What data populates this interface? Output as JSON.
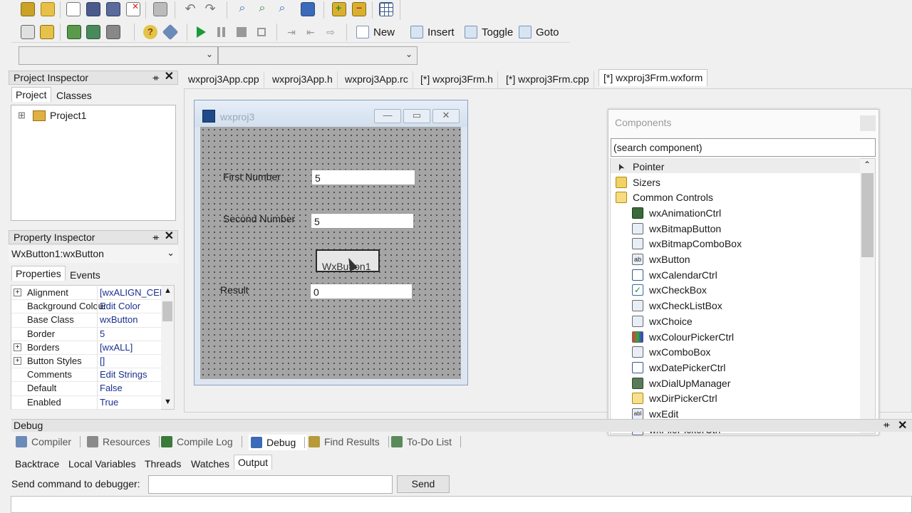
{
  "toolbar2": {
    "new": "New",
    "insert": "Insert",
    "toggle": "Toggle",
    "goto": "Goto"
  },
  "project_inspector": {
    "title": "Project Inspector",
    "pin": "ᚑ",
    "tabs": [
      "Project",
      "Classes"
    ],
    "tree_root": "Project1",
    "expander": "⊞"
  },
  "property_inspector": {
    "title": "Property Inspector",
    "object": "WxButton1:wxButton",
    "tabs": [
      "Properties",
      "Events"
    ],
    "rows": [
      {
        "key": "Alignment",
        "value": "[wxALIGN_CEN",
        "expandable": true
      },
      {
        "key": "Background Colour",
        "value": "Edit Color",
        "expandable": false
      },
      {
        "key": "Base Class",
        "value": "wxButton",
        "expandable": false
      },
      {
        "key": "Border",
        "value": "5",
        "expandable": false
      },
      {
        "key": "Borders",
        "value": "[wxALL]",
        "expandable": true
      },
      {
        "key": "Button Styles",
        "value": "[]",
        "expandable": true
      },
      {
        "key": "Comments",
        "value": "Edit Strings",
        "expandable": false
      },
      {
        "key": "Default",
        "value": "False",
        "expandable": false
      },
      {
        "key": "Enabled",
        "value": "True",
        "expandable": false
      }
    ]
  },
  "editor_tabs": [
    "wxproj3App.cpp",
    "wxproj3App.h",
    "wxproj3App.rc",
    "[*] wxproj3Frm.h",
    "[*] wxproj3Frm.cpp",
    "[*] wxproj3Frm.wxform"
  ],
  "form": {
    "title": "wxproj3",
    "first_label": "First Number",
    "first_value": "5",
    "second_label": "Second Number",
    "second_value": "5",
    "button_label": "WxButton1",
    "result_label": "Result",
    "result_value": "0"
  },
  "components": {
    "title": "Components",
    "search_placeholder": "(search component)",
    "items": [
      {
        "label": "Pointer",
        "icon": "pointer-icon"
      },
      {
        "label": "Sizers",
        "icon": "folder-icon"
      },
      {
        "label": "Common Controls",
        "icon": "folder-open-icon"
      },
      {
        "label": "wxAnimationCtrl",
        "icon": "film-icon"
      },
      {
        "label": "wxBitmapButton",
        "icon": "bitmap-button-icon"
      },
      {
        "label": "wxBitmapComboBox",
        "icon": "bitmap-combo-icon"
      },
      {
        "label": "wxButton",
        "icon": "button-icon"
      },
      {
        "label": "wxCalendarCtrl",
        "icon": "calendar-icon"
      },
      {
        "label": "wxCheckBox",
        "icon": "checkbox-icon"
      },
      {
        "label": "wxCheckListBox",
        "icon": "checklist-icon"
      },
      {
        "label": "wxChoice",
        "icon": "choice-icon"
      },
      {
        "label": "wxColourPickerCtrl",
        "icon": "colour-picker-icon"
      },
      {
        "label": "wxComboBox",
        "icon": "combobox-icon"
      },
      {
        "label": "wxDatePickerCtrl",
        "icon": "date-picker-icon"
      },
      {
        "label": "wxDialUpManager",
        "icon": "dialup-icon"
      },
      {
        "label": "wxDirPickerCtrl",
        "icon": "dir-picker-icon"
      },
      {
        "label": "wxEdit",
        "icon": "edit-icon"
      },
      {
        "label": "wxFilePickerCtrl",
        "icon": "file-picker-icon"
      }
    ]
  },
  "debug": {
    "title": "Debug",
    "top_tabs": [
      "Compiler",
      "Resources",
      "Compile Log",
      "Debug",
      "Find Results",
      "To-Do List"
    ],
    "sub_tabs": [
      "Backtrace",
      "Local Variables",
      "Threads",
      "Watches",
      "Output"
    ],
    "command_label": "Send command to debugger:",
    "send": "Send"
  }
}
